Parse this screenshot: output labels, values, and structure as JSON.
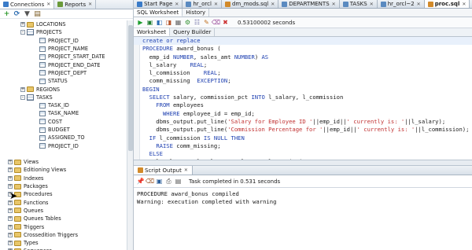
{
  "left_tabs": [
    {
      "label": "Connections",
      "active": true
    },
    {
      "label": "Reports",
      "active": false
    }
  ],
  "tree": [
    {
      "indent": 3,
      "toggle": "+",
      "icon": "folder",
      "label": "LOCATIONS"
    },
    {
      "indent": 3,
      "toggle": "-",
      "icon": "table",
      "label": "PROJECTS"
    },
    {
      "indent": 5,
      "toggle": "",
      "icon": "column",
      "label": "PROJECT_ID"
    },
    {
      "indent": 5,
      "toggle": "",
      "icon": "column",
      "label": "PROJECT_NAME"
    },
    {
      "indent": 5,
      "toggle": "",
      "icon": "column",
      "label": "PROJECT_START_DATE"
    },
    {
      "indent": 5,
      "toggle": "",
      "icon": "column",
      "label": "PROJECT_END_DATE"
    },
    {
      "indent": 5,
      "toggle": "",
      "icon": "column",
      "label": "PROJECT_DEPT"
    },
    {
      "indent": 5,
      "toggle": "",
      "icon": "column",
      "label": "STATUS"
    },
    {
      "indent": 3,
      "toggle": "+",
      "icon": "folder",
      "label": "REGIONS"
    },
    {
      "indent": 3,
      "toggle": "-",
      "icon": "table",
      "label": "TASKS"
    },
    {
      "indent": 5,
      "toggle": "",
      "icon": "column",
      "label": "TASK_ID"
    },
    {
      "indent": 5,
      "toggle": "",
      "icon": "column",
      "label": "TASK_NAME"
    },
    {
      "indent": 5,
      "toggle": "",
      "icon": "column",
      "label": "COST"
    },
    {
      "indent": 5,
      "toggle": "",
      "icon": "column",
      "label": "BUDGET"
    },
    {
      "indent": 5,
      "toggle": "",
      "icon": "column",
      "label": "ASSIGNED_TO"
    },
    {
      "indent": 5,
      "toggle": "",
      "icon": "column",
      "label": "PROJECT_ID"
    },
    {
      "indent": 1,
      "toggle": "",
      "icon": "none",
      "label": ""
    },
    {
      "indent": 1,
      "toggle": "+",
      "icon": "folder",
      "label": "Views"
    },
    {
      "indent": 1,
      "toggle": "+",
      "icon": "folder",
      "label": "Editioning Views"
    },
    {
      "indent": 1,
      "toggle": "+",
      "icon": "folder",
      "label": "Indexes"
    },
    {
      "indent": 1,
      "toggle": "+",
      "icon": "folder",
      "label": "Packages"
    },
    {
      "indent": 1,
      "toggle": "+",
      "icon": "folder",
      "label": "Procedures"
    },
    {
      "indent": 1,
      "toggle": "+",
      "icon": "folder",
      "label": "Functions"
    },
    {
      "indent": 1,
      "toggle": "+",
      "icon": "folder",
      "label": "Queues"
    },
    {
      "indent": 1,
      "toggle": "+",
      "icon": "folder",
      "label": "Queues Tables"
    },
    {
      "indent": 1,
      "toggle": "+",
      "icon": "folder",
      "label": "Triggers"
    },
    {
      "indent": 1,
      "toggle": "+",
      "icon": "folder",
      "label": "Crossedition Triggers"
    },
    {
      "indent": 1,
      "toggle": "+",
      "icon": "folder",
      "label": "Types"
    },
    {
      "indent": 1,
      "toggle": "+",
      "icon": "folder",
      "label": "Sequences"
    }
  ],
  "doc_tabs": [
    {
      "label": "Start Page",
      "active": false
    },
    {
      "label": "hr_orcl",
      "active": false
    },
    {
      "label": "dm_mods.sql",
      "active": false
    },
    {
      "label": "DEPARTMENTS",
      "active": false
    },
    {
      "label": "TASKS",
      "active": false
    },
    {
      "label": "hr_orcl~2",
      "active": false
    },
    {
      "label": "proc.sql",
      "active": true
    }
  ],
  "sub_tabs": [
    {
      "label": "SQL Worksheet",
      "active": true
    },
    {
      "label": "History",
      "active": false
    }
  ],
  "timing": "0.53100002 seconds",
  "worksheet_tabs": [
    {
      "label": "Worksheet",
      "active": true
    },
    {
      "label": "Query Builder",
      "active": false
    }
  ],
  "code_lines": [
    "create or replace",
    "PROCEDURE award_bonus (",
    "  emp_id NUMBER, sales_amt NUMBER) AS",
    "  l_salary    REAL;",
    "  l_commission    REAL;",
    "  comm_missing  EXCEPTION;",
    "BEGIN",
    "  SELECT salary, commission_pct INTO l_salary, l_commission",
    "    FROM employees",
    "      WHERE employee_id = emp_id;",
    "    dbms_output.put_line('Salary for Employee ID '||emp_id||' currently is: '||l_salary);",
    "    dbms_output.put_line('Commission Percentage for '||emp_id||' currently is: '||l_commission);",
    "  IF l_commission IS NULL THEN",
    "    RAISE comm_missing;",
    "  ELSE",
    "    l_salary := l_salary + sales_amt*l_commission;"
  ],
  "output_tab": "Script Output",
  "task_status": "Task completed in 0.531 seconds",
  "output_lines": [
    "PROCEDURE award_bonus compiled",
    "Warning: execution completed with warning"
  ]
}
